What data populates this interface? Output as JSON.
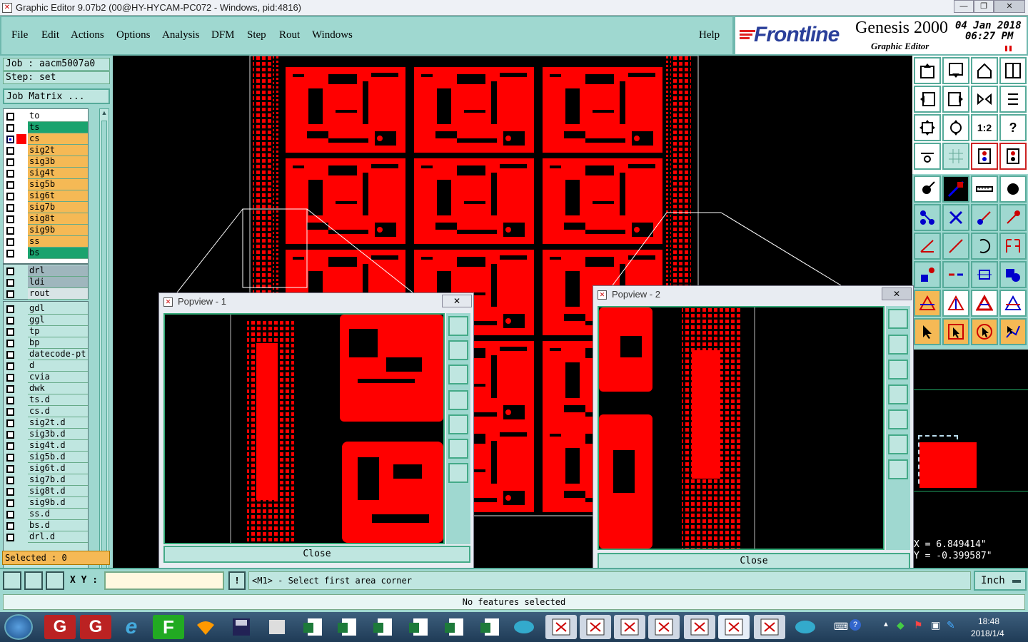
{
  "window": {
    "title": "Graphic Editor 9.07b2 (00@HY-HYCAM-PC072 - Windows, pid:4816)",
    "min": "—",
    "max": "❐",
    "close": "✕"
  },
  "menu": {
    "file": "File",
    "edit": "Edit",
    "actions": "Actions",
    "options": "Options",
    "analysis": "Analysis",
    "dfm": "DFM",
    "step": "Step",
    "rout": "Rout",
    "windows": "Windows",
    "help": "Help"
  },
  "brand": {
    "logo": "Frontline",
    "product": "Genesis 2000",
    "subtitle": "Graphic Editor",
    "date": "04 Jan 2018",
    "time": "06:27 PM"
  },
  "job": {
    "job": "Job : aacm5007a0",
    "step": "Step: set",
    "matrix": "Job Matrix ..."
  },
  "layers_board": [
    {
      "name": "to",
      "color": "#ffffff",
      "swatch": ""
    },
    {
      "name": "ts",
      "color": "#1aa36e",
      "swatch": ""
    },
    {
      "name": "cs",
      "color": "#f5b955",
      "swatch": "#ff0000",
      "active": true
    },
    {
      "name": "sig2t",
      "color": "#f5b955",
      "swatch": ""
    },
    {
      "name": "sig3b",
      "color": "#f5b955",
      "swatch": ""
    },
    {
      "name": "sig4t",
      "color": "#f5b955",
      "swatch": ""
    },
    {
      "name": "sig5b",
      "color": "#f5b955",
      "swatch": ""
    },
    {
      "name": "sig6t",
      "color": "#f5b955",
      "swatch": ""
    },
    {
      "name": "sig7b",
      "color": "#f5b955",
      "swatch": ""
    },
    {
      "name": "sig8t",
      "color": "#f5b955",
      "swatch": ""
    },
    {
      "name": "sig9b",
      "color": "#f5b955",
      "swatch": ""
    },
    {
      "name": "ss",
      "color": "#f5b955",
      "swatch": ""
    },
    {
      "name": "bs",
      "color": "#1aa36e",
      "swatch": ""
    }
  ],
  "layers_drill": [
    {
      "name": "drl",
      "color": "#9fb6bd"
    },
    {
      "name": "ldi",
      "color": "#9fb6bd"
    },
    {
      "name": "rout",
      "color": "#d8e4e6"
    }
  ],
  "layers_misc": [
    "gdl",
    "ggl",
    "tp",
    "bp",
    "datecode-pt",
    "d",
    "cvia",
    "dwk",
    "ts.d",
    "cs.d",
    "sig2t.d",
    "sig3b.d",
    "sig4t.d",
    "sig5b.d",
    "sig6t.d",
    "sig7b.d",
    "sig8t.d",
    "sig9b.d",
    "ss.d",
    "bs.d",
    "drl.d"
  ],
  "selected": "Selected : 0",
  "popup1": {
    "title": "Popview - 1",
    "close": "Close"
  },
  "popup2": {
    "title": "Popview - 2",
    "close": "Close"
  },
  "coords": {
    "x": "X = 6.849414\"",
    "y": "Y = -0.399587\""
  },
  "bottom": {
    "xy_label": "X Y :",
    "xy_value": "",
    "prompt": "<M1> - Select first area corner",
    "units": "Inch",
    "status": "No features selected"
  },
  "taskbar": {
    "time": "18:48",
    "date": "2018/1/4"
  },
  "colors": {
    "panel": "#9fd8d0",
    "copper": "#ff0000",
    "accent_green": "#1aa36e",
    "accent_orange": "#f5b955"
  }
}
